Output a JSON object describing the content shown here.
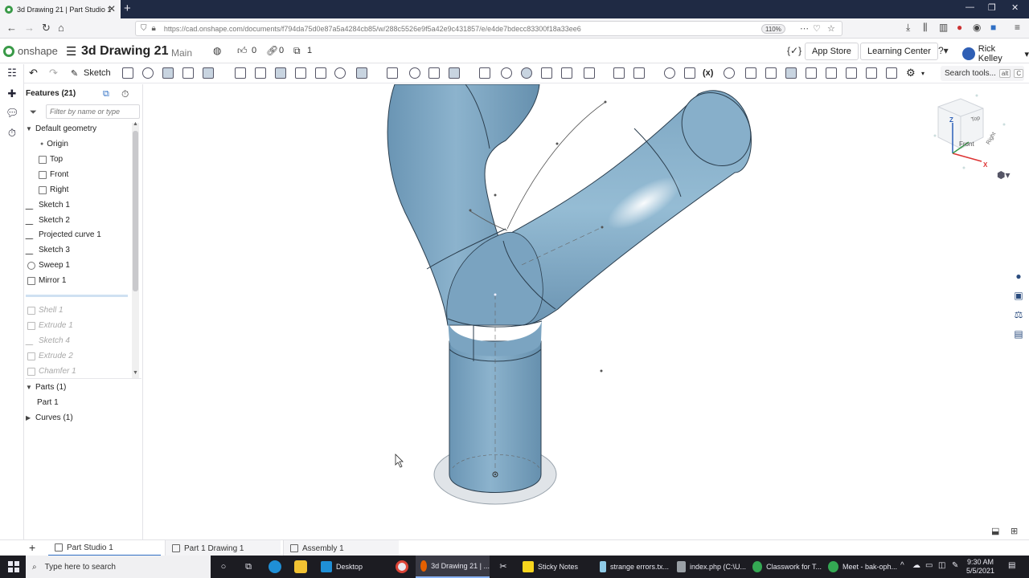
{
  "browser": {
    "tab_title": "3d Drawing 21 | Part Studio 1",
    "url": "https://cad.onshape.com/documents/f794da75d0e87a5a4284cb85/w/288c5526e9f5a42e9c431857/e/e4de7bdecc83300f18a33ee6",
    "zoom": "110%"
  },
  "header": {
    "logo_text": "onshape",
    "doc_title": "3d Drawing 21",
    "branch": "Main",
    "likes": "0",
    "links": "0",
    "versions": "1",
    "app_store": "App Store",
    "learning_center": "Learning Center",
    "user_name": "Rick Kelley"
  },
  "toolbar": {
    "sketch_label": "Sketch",
    "search_label": "Search tools...",
    "search_kbd1": "alt",
    "search_kbd2": "C"
  },
  "features": {
    "title": "Features (21)",
    "filter_placeholder": "Filter by name or type",
    "default_geometry": "Default geometry",
    "origin": "Origin",
    "planes": [
      "Top",
      "Front",
      "Right"
    ],
    "active": [
      "Sketch 1",
      "Sketch 2",
      "Projected curve 1",
      "Sketch 3",
      "Sweep 1",
      "Mirror 1"
    ],
    "suppressed": [
      "Shell 1",
      "Extrude 1",
      "Sketch 4",
      "Extrude 2",
      "Chamfer 1"
    ],
    "parts_header": "Parts (1)",
    "part": "Part 1",
    "curves_header": "Curves (1)"
  },
  "viewcube": {
    "top": "Top",
    "front": "Front",
    "right": "Right",
    "axis_x": "X",
    "axis_z": "Z"
  },
  "bottom_tabs": [
    "Part Studio 1",
    "Part 1 Drawing 1",
    "Assembly 1"
  ],
  "taskbar": {
    "search_placeholder": "Type here to search",
    "apps": [
      "Desktop",
      "3d Drawing 21 | ...",
      "Sticky Notes",
      "strange errors.tx...",
      "index.php (C:\\U...",
      "Classwork for T...",
      "Meet - bak-oph..."
    ],
    "time": "9:30 AM",
    "date": "5/5/2021"
  },
  "colors": {
    "part_fill": "#7fa8c4",
    "part_shadow": "#5f8aa8",
    "onshape_green": "#3a9a48",
    "accent_blue": "#2f6fc4"
  }
}
